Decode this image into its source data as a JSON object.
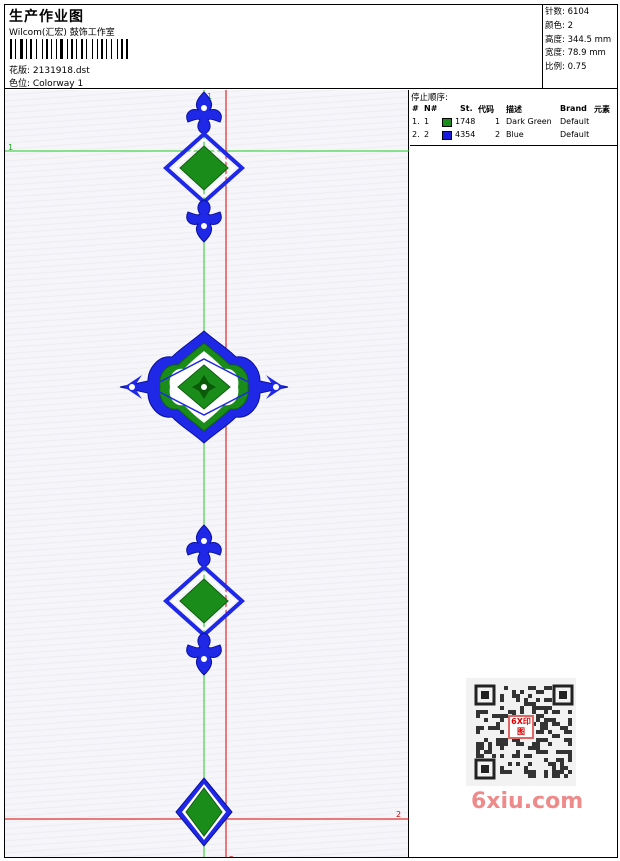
{
  "header": {
    "title": "生产作业图",
    "studio": "Wilcom(汇宏) 鼓饰工作室",
    "design_label": "花版: 2131918.dst",
    "colorway_label": "色位: Colorway 1"
  },
  "stats": {
    "stitches": "针数: 6104",
    "colors": "颜色: 2",
    "height": "高度: 344.5 mm",
    "width": "宽度: 78.9 mm",
    "scale": "比例: 0.75"
  },
  "guides": {
    "green_h_label": "1",
    "green_v_label": "1",
    "red_h_label": "2",
    "red_v_label": "2"
  },
  "stop_sequence": {
    "title": "停止顺序:",
    "headers": {
      "hash": "#",
      "n": "N#",
      "st": "St.",
      "code": "代码",
      "desc": "描述",
      "brand": "Brand",
      "element": "元素"
    },
    "rows": [
      {
        "hash": "1.",
        "n": "1",
        "st": "1748",
        "code": "1",
        "desc": "Dark Green",
        "brand": "Default",
        "color": "#1a8c1a"
      },
      {
        "hash": "2.",
        "n": "2",
        "st": "4354",
        "code": "2",
        "desc": "Blue",
        "brand": "Default",
        "color": "#1a1adc"
      }
    ]
  },
  "qr": {
    "stamp": "6X印图"
  },
  "watermark": "6xiu.com",
  "colors": {
    "green": "#1a8c1a",
    "blue": "#1e28e6",
    "guide_green": "#22cc22",
    "guide_red": "#dd0000"
  }
}
